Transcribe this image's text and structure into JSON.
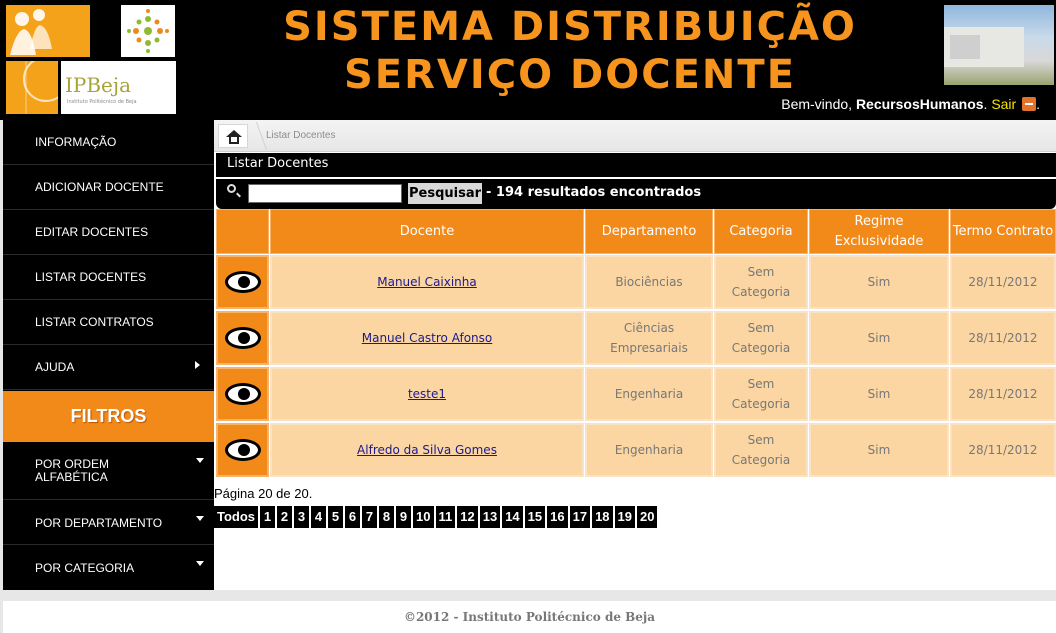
{
  "header": {
    "title_line1": "SISTEMA DISTRIBUIÇÃO",
    "title_line2": "SERVIÇO DOCENTE",
    "logo_text": "IPBeja",
    "logo_sub": "Instituto Politécnico de Beja",
    "welcome_prefix": "Bem-vindo, ",
    "username": "RecursosHumanos",
    "welcome_dot": ". ",
    "logout_label": "Sair",
    "welcome_end": "."
  },
  "sidebar": {
    "items": [
      {
        "label": "INFORMAÇÃO"
      },
      {
        "label": "ADICIONAR DOCENTE"
      },
      {
        "label": "EDITAR DOCENTES"
      },
      {
        "label": "LISTAR DOCENTES"
      },
      {
        "label": "LISTAR CONTRATOS"
      },
      {
        "label": "AJUDA"
      }
    ],
    "filters_title": "FILTROS",
    "filters": [
      {
        "label": "POR ORDEM ALFABÉTICA"
      },
      {
        "label": "POR DEPARTAMENTO"
      },
      {
        "label": "POR CATEGORIA"
      }
    ]
  },
  "breadcrumb": {
    "current": "Listar Docentes"
  },
  "main": {
    "list_title": "Listar Docentes",
    "search": {
      "value": "",
      "placeholder": "",
      "button_label": "Pesquisar",
      "results_text": "- 194 resultados encontrados"
    },
    "columns": [
      "Docente",
      "Departamento",
      "Categoria",
      "Regime Exclusividade",
      "Termo Contrato"
    ],
    "rows": [
      {
        "docente": "Manuel Caixinha",
        "departamento": "Biociências",
        "categoria": "Sem Categoria",
        "regime": "Sim",
        "termo": "28/11/2012"
      },
      {
        "docente": "Manuel Castro Afonso",
        "departamento": "Ciências Empresariais",
        "categoria": "Sem Categoria",
        "regime": "Sim",
        "termo": "28/11/2012"
      },
      {
        "docente": "teste1",
        "departamento": "Engenharia",
        "categoria": "Sem Categoria",
        "regime": "Sim",
        "termo": "28/11/2012"
      },
      {
        "docente": "Alfredo da Silva Gomes",
        "departamento": "Engenharia",
        "categoria": "Sem Categoria",
        "regime": "Sim",
        "termo": "28/11/2012"
      }
    ],
    "page_info": "Página 20 de 20.",
    "pagination": [
      "Todos",
      "1",
      "2",
      "3",
      "4",
      "5",
      "6",
      "7",
      "8",
      "9",
      "10",
      "11",
      "12",
      "13",
      "14",
      "15",
      "16",
      "17",
      "18",
      "19",
      "20"
    ]
  },
  "footer": {
    "text": "©2012 - Instituto Politécnico de Beja"
  },
  "colors": {
    "accent": "#f28a1a",
    "title": "#f7941d",
    "row_bg": "#fbd6a3",
    "link": "#1a1a8c"
  }
}
